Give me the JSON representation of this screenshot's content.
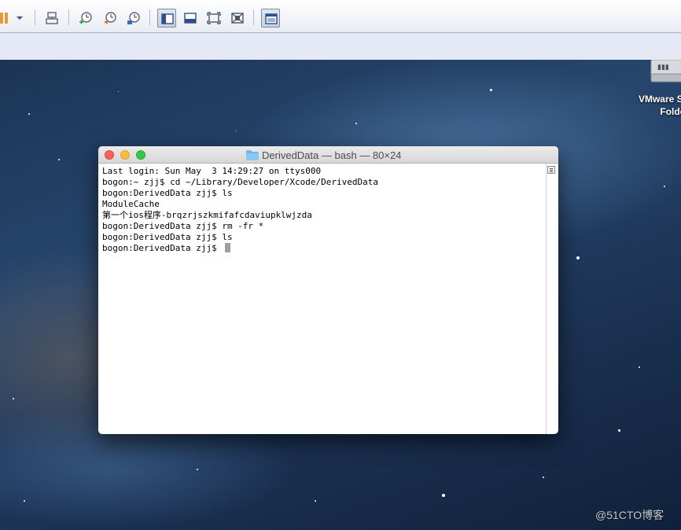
{
  "toolbar": {
    "buttons": [
      {
        "name": "pause-icon"
      },
      {
        "name": "dropdown-arrow-icon"
      },
      {
        "name": "send-ctrl-alt-del-icon"
      },
      {
        "name": "take-snapshot-icon"
      },
      {
        "name": "revert-snapshot-icon"
      },
      {
        "name": "snapshot-manager-icon"
      },
      {
        "name": "show-library-icon"
      },
      {
        "name": "show-thumbnail-bar-icon"
      },
      {
        "name": "full-screen-icon"
      },
      {
        "name": "unity-icon"
      },
      {
        "name": "console-view-icon"
      }
    ]
  },
  "desktop": {
    "shared_folder_label": "VMware Sh\nFolder"
  },
  "terminal": {
    "title": "DerivedData — bash — 80×24",
    "lines": [
      "Last login: Sun May  3 14:29:27 on ttys000",
      "bogon:~ zjj$ cd ~/Library/Developer/Xcode/DerivedData",
      "bogon:DerivedData zjj$ ls",
      "ModuleCache",
      "第一个ios程序-brqzrjszkmifafcdaviupklwjzda",
      "bogon:DerivedData zjj$ rm -fr *",
      "bogon:DerivedData zjj$ ls",
      "bogon:DerivedData zjj$ "
    ]
  },
  "watermark": "@51CTO博客",
  "colors": {
    "close": "#fc605c",
    "minimize": "#fdbc40",
    "maximize": "#34c84a",
    "folder": "#6fb7ee"
  }
}
